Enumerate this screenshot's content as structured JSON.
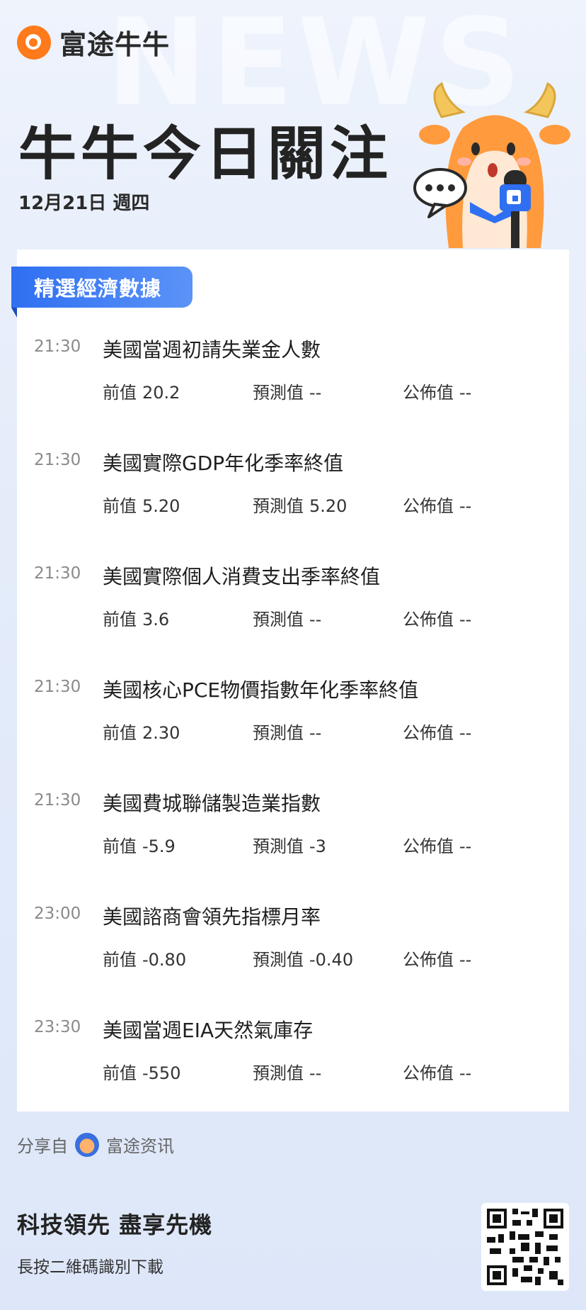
{
  "brand": {
    "name": "富途牛牛",
    "watermark": "NEWS"
  },
  "headline": "牛牛今日關注",
  "date": "12月21日 週四",
  "section": {
    "label": "精選經濟數據"
  },
  "labels": {
    "prev": "前值",
    "forecast": "預測值",
    "published": "公佈值"
  },
  "events": [
    {
      "time": "21:30",
      "title": "美國當週初請失業金人數",
      "prev": "20.2",
      "forecast": "--",
      "published": "--"
    },
    {
      "time": "21:30",
      "title": "美國實際GDP年化季率終值",
      "prev": "5.20",
      "forecast": "5.20",
      "published": "--"
    },
    {
      "time": "21:30",
      "title": "美國實際個人消費支出季率終值",
      "prev": "3.6",
      "forecast": "--",
      "published": "--"
    },
    {
      "time": "21:30",
      "title": "美國核心PCE物價指數年化季率終值",
      "prev": "2.30",
      "forecast": "--",
      "published": "--"
    },
    {
      "time": "21:30",
      "title": "美國費城聯儲製造業指數",
      "prev": "-5.9",
      "forecast": "-3",
      "published": "--"
    },
    {
      "time": "23:00",
      "title": "美國諮商會領先指標月率",
      "prev": "-0.80",
      "forecast": "-0.40",
      "published": "--"
    },
    {
      "time": "23:30",
      "title": "美國當週EIA天然氣庫存",
      "prev": "-550",
      "forecast": "--",
      "published": "--"
    }
  ],
  "share": {
    "prefix": "分享自",
    "source": "富途资讯"
  },
  "footer": {
    "title": "科技領先 盡享先機",
    "subtitle": "長按二維碼識別下載"
  },
  "colors": {
    "accent": "#2f6ff1",
    "brand_orange": "#ff7a1a"
  },
  "icons": {
    "logo": "futu-logo-icon",
    "mascot": "bull-mascot-microphone",
    "qr": "qr-code"
  }
}
